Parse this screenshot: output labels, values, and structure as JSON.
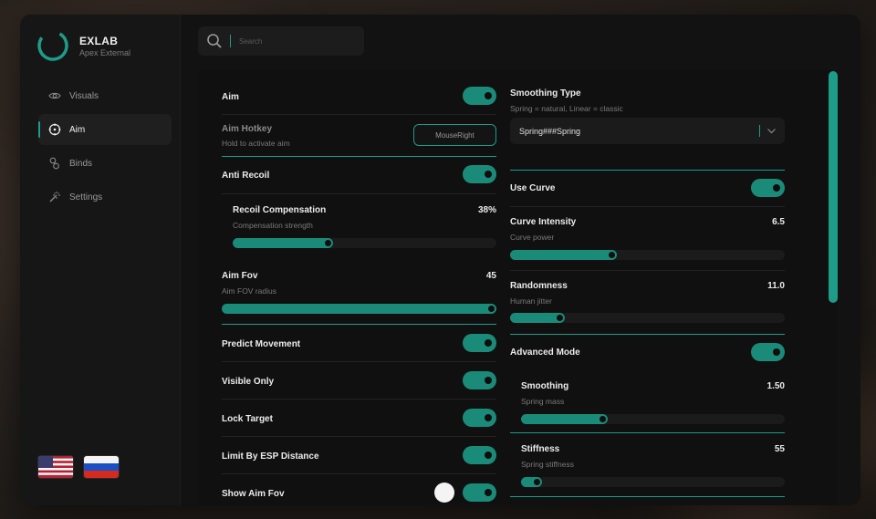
{
  "app": {
    "name": "EXLAB",
    "subtitle": "Apex External"
  },
  "colors": {
    "accent": "#1b8b79",
    "window": "#121212",
    "sidebar": "#161616"
  },
  "sidebar": {
    "items": [
      {
        "label": "Visuals",
        "icon": "eye-icon",
        "active": false
      },
      {
        "label": "Aim",
        "icon": "crosshair-icon",
        "active": true
      },
      {
        "label": "Binds",
        "icon": "link-icon",
        "active": false
      },
      {
        "label": "Settings",
        "icon": "wand-icon",
        "active": false
      }
    ],
    "languages": [
      {
        "icon": "us-flag-icon"
      },
      {
        "icon": "ru-flag-icon"
      }
    ]
  },
  "search": {
    "placeholder": "Search",
    "value": ""
  },
  "left_column": {
    "aim": {
      "label": "Aim",
      "enabled": true
    },
    "aim_hotkey": {
      "label": "Aim Hotkey",
      "desc": "Hold to activate aim",
      "button": "MouseRight"
    },
    "anti_recoil": {
      "label": "Anti Recoil",
      "enabled": true
    },
    "recoil_compensation": {
      "label": "Recoil Compensation",
      "desc": "Compensation strength",
      "value": "38%",
      "fraction": 0.38
    },
    "aim_fov": {
      "label": "Aim Fov",
      "desc": "Aim FOV radius",
      "value": "45",
      "fraction": 1.0
    },
    "predict_movement": {
      "label": "Predict Movement",
      "enabled": true
    },
    "visible_only": {
      "label": "Visible Only",
      "enabled": true
    },
    "lock_target": {
      "label": "Lock Target",
      "enabled": true
    },
    "limit_esp": {
      "label": "Limit By ESP Distance",
      "enabled": true
    },
    "show_aim_fov": {
      "label": "Show Aim Fov",
      "enabled": true
    }
  },
  "right_column": {
    "smoothing_type": {
      "label": "Smoothing Type",
      "desc": "Spring = natural, Linear = classic",
      "selected": "Spring###Spring"
    },
    "use_curve": {
      "label": "Use Curve",
      "enabled": true
    },
    "curve_intensity": {
      "label": "Curve Intensity",
      "desc": "Curve power",
      "value": "6.5",
      "fraction": 0.39
    },
    "randomness": {
      "label": "Randomness",
      "desc": "Human jitter",
      "value": "11.0",
      "fraction": 0.2
    },
    "advanced_mode": {
      "label": "Advanced Mode",
      "enabled": true
    },
    "smoothing": {
      "label": "Smoothing",
      "desc": "Spring mass",
      "value": "1.50",
      "fraction": 0.33
    },
    "stiffness": {
      "label": "Stiffness",
      "desc": "Spring stiffness",
      "value": "55",
      "fraction": 0.08
    }
  }
}
